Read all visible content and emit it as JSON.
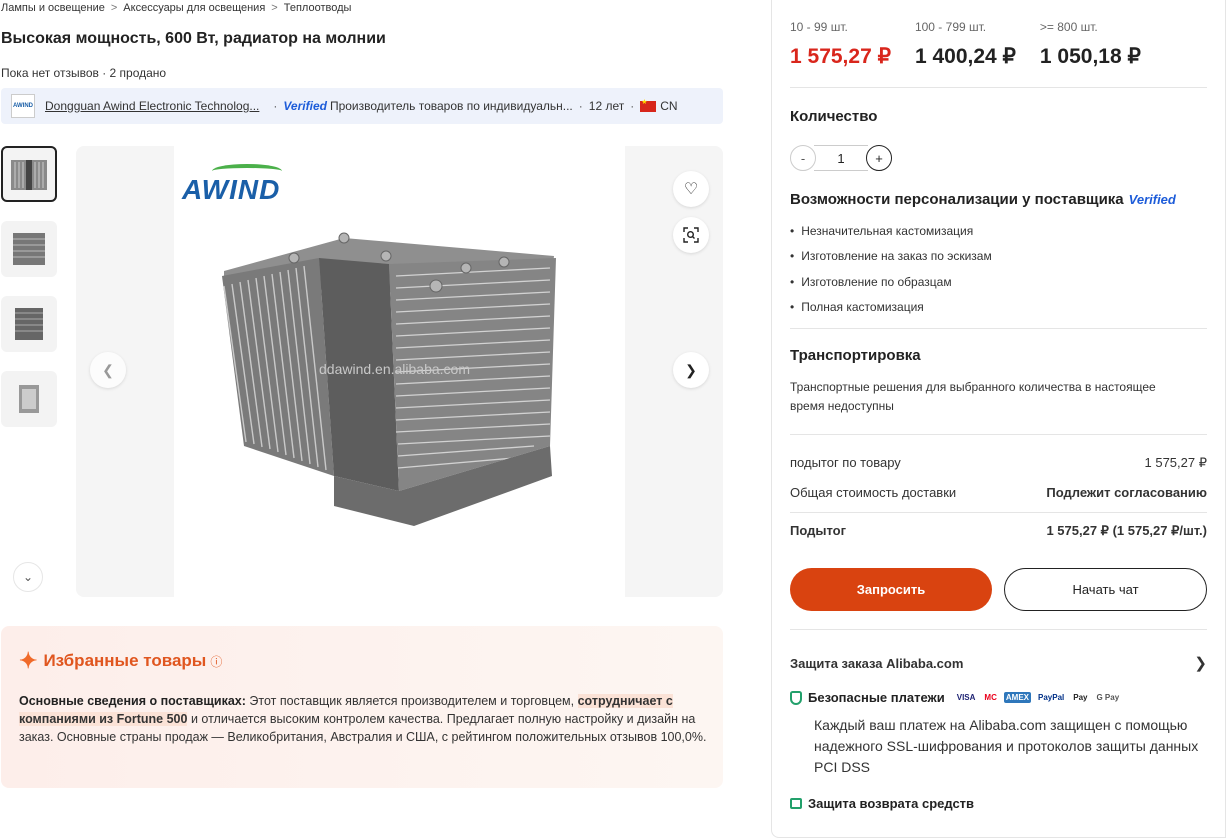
{
  "breadcrumb": {
    "items": [
      "Лампы и освещение",
      "Аксессуары для освещения",
      "Теплоотводы"
    ],
    "separator": ">"
  },
  "product": {
    "title": "Высокая мощность, 600 Вт, радиатор на молнии",
    "reviews": "Пока нет отзывов · 2 продано"
  },
  "supplier": {
    "logo_text": "AWIND",
    "name": "Dongguan Awind Electronic Technolog...",
    "verified": "Verified",
    "type": "Производитель товаров по индивидуальн...",
    "years": "12 лет",
    "country": "CN"
  },
  "gallery": {
    "logo": "AWIND",
    "watermark": "ddawind.en.alibaba.com",
    "thumbnail_count": 4
  },
  "ai": {
    "title": "Избранные товары",
    "info_icon": "ⓘ",
    "label": "Основные сведения о поставщиках:",
    "text_1": " Этот поставщик является производителем и торговцем, ",
    "highlight": "сотрудничает с компаниями из Fortune 500",
    "text_2": " и отличается высоким контролем качества. Предлагает полную настройку и дизайн на заказ. Основные страны продаж — Великобритания, Австралия и США, с рейтингом положительных отзывов 100,0%."
  },
  "pricing": {
    "tiers": [
      {
        "qty": "10 - 99 шт.",
        "price": "1 575,27 ₽"
      },
      {
        "qty": "100 - 799 шт.",
        "price": "1 400,24 ₽"
      },
      {
        "qty": ">= 800 шт.",
        "price": "1 050,18 ₽"
      }
    ]
  },
  "quantity": {
    "title": "Количество",
    "minus": "-",
    "value": "1",
    "plus": "+"
  },
  "customization": {
    "title": "Возможности персонализации у поставщика",
    "verified": "Verified",
    "items": [
      "Незначительная кастомизация",
      "Изготовление на заказ по эскизам",
      "Изготовление по образцам",
      "Полная кастомизация"
    ]
  },
  "shipping": {
    "title": "Транспортировка",
    "text": "Транспортные решения для выбранного количества в настоящее время недоступны"
  },
  "summary": {
    "item_subtotal_label": "подытог по товару",
    "item_subtotal_value": "1 575,27 ₽",
    "shipping_label": "Общая стоимость доставки",
    "shipping_value": "Подлежит согласованию",
    "subtotal_label": "Подытог",
    "subtotal_value": "1 575,27 ₽ (1 575,27 ₽/шт.)"
  },
  "actions": {
    "inquire": "Запросить",
    "chat": "Начать чат"
  },
  "protection": {
    "title": "Защита заказа Alibaba.com",
    "secure_title": "Безопасные платежи",
    "payment_methods": [
      "VISA",
      "MC",
      "AMEX",
      "PayPal",
      "Pay",
      "G Pay"
    ],
    "secure_text": "Каждый ваш платеж на Alibaba.com защищен с помощью надежного SSL-шифрования и протоколов защиты данных PCI DSS",
    "refund_title": "Защита возврата средств"
  },
  "colors": {
    "accent": "#d94310",
    "price_red": "#d9261c",
    "verified_blue": "#1d5cd9",
    "ai_orange": "#e0561f"
  }
}
